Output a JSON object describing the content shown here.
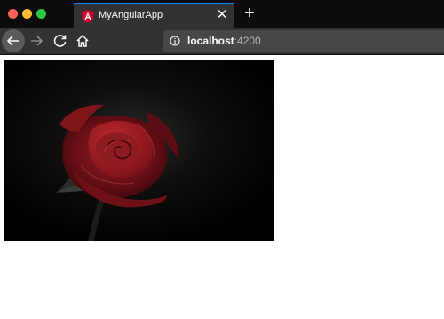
{
  "browser": {
    "tab": {
      "title": "MyAngularApp",
      "favicon": "angular-logo"
    },
    "url": {
      "host": "localhost",
      "port": ":4200"
    }
  },
  "content": {
    "image_subject": "red rose on black background"
  },
  "colors": {
    "tab_accent": "#0a84ff",
    "angular_red": "#c3002f",
    "toolbar": "#323234"
  }
}
